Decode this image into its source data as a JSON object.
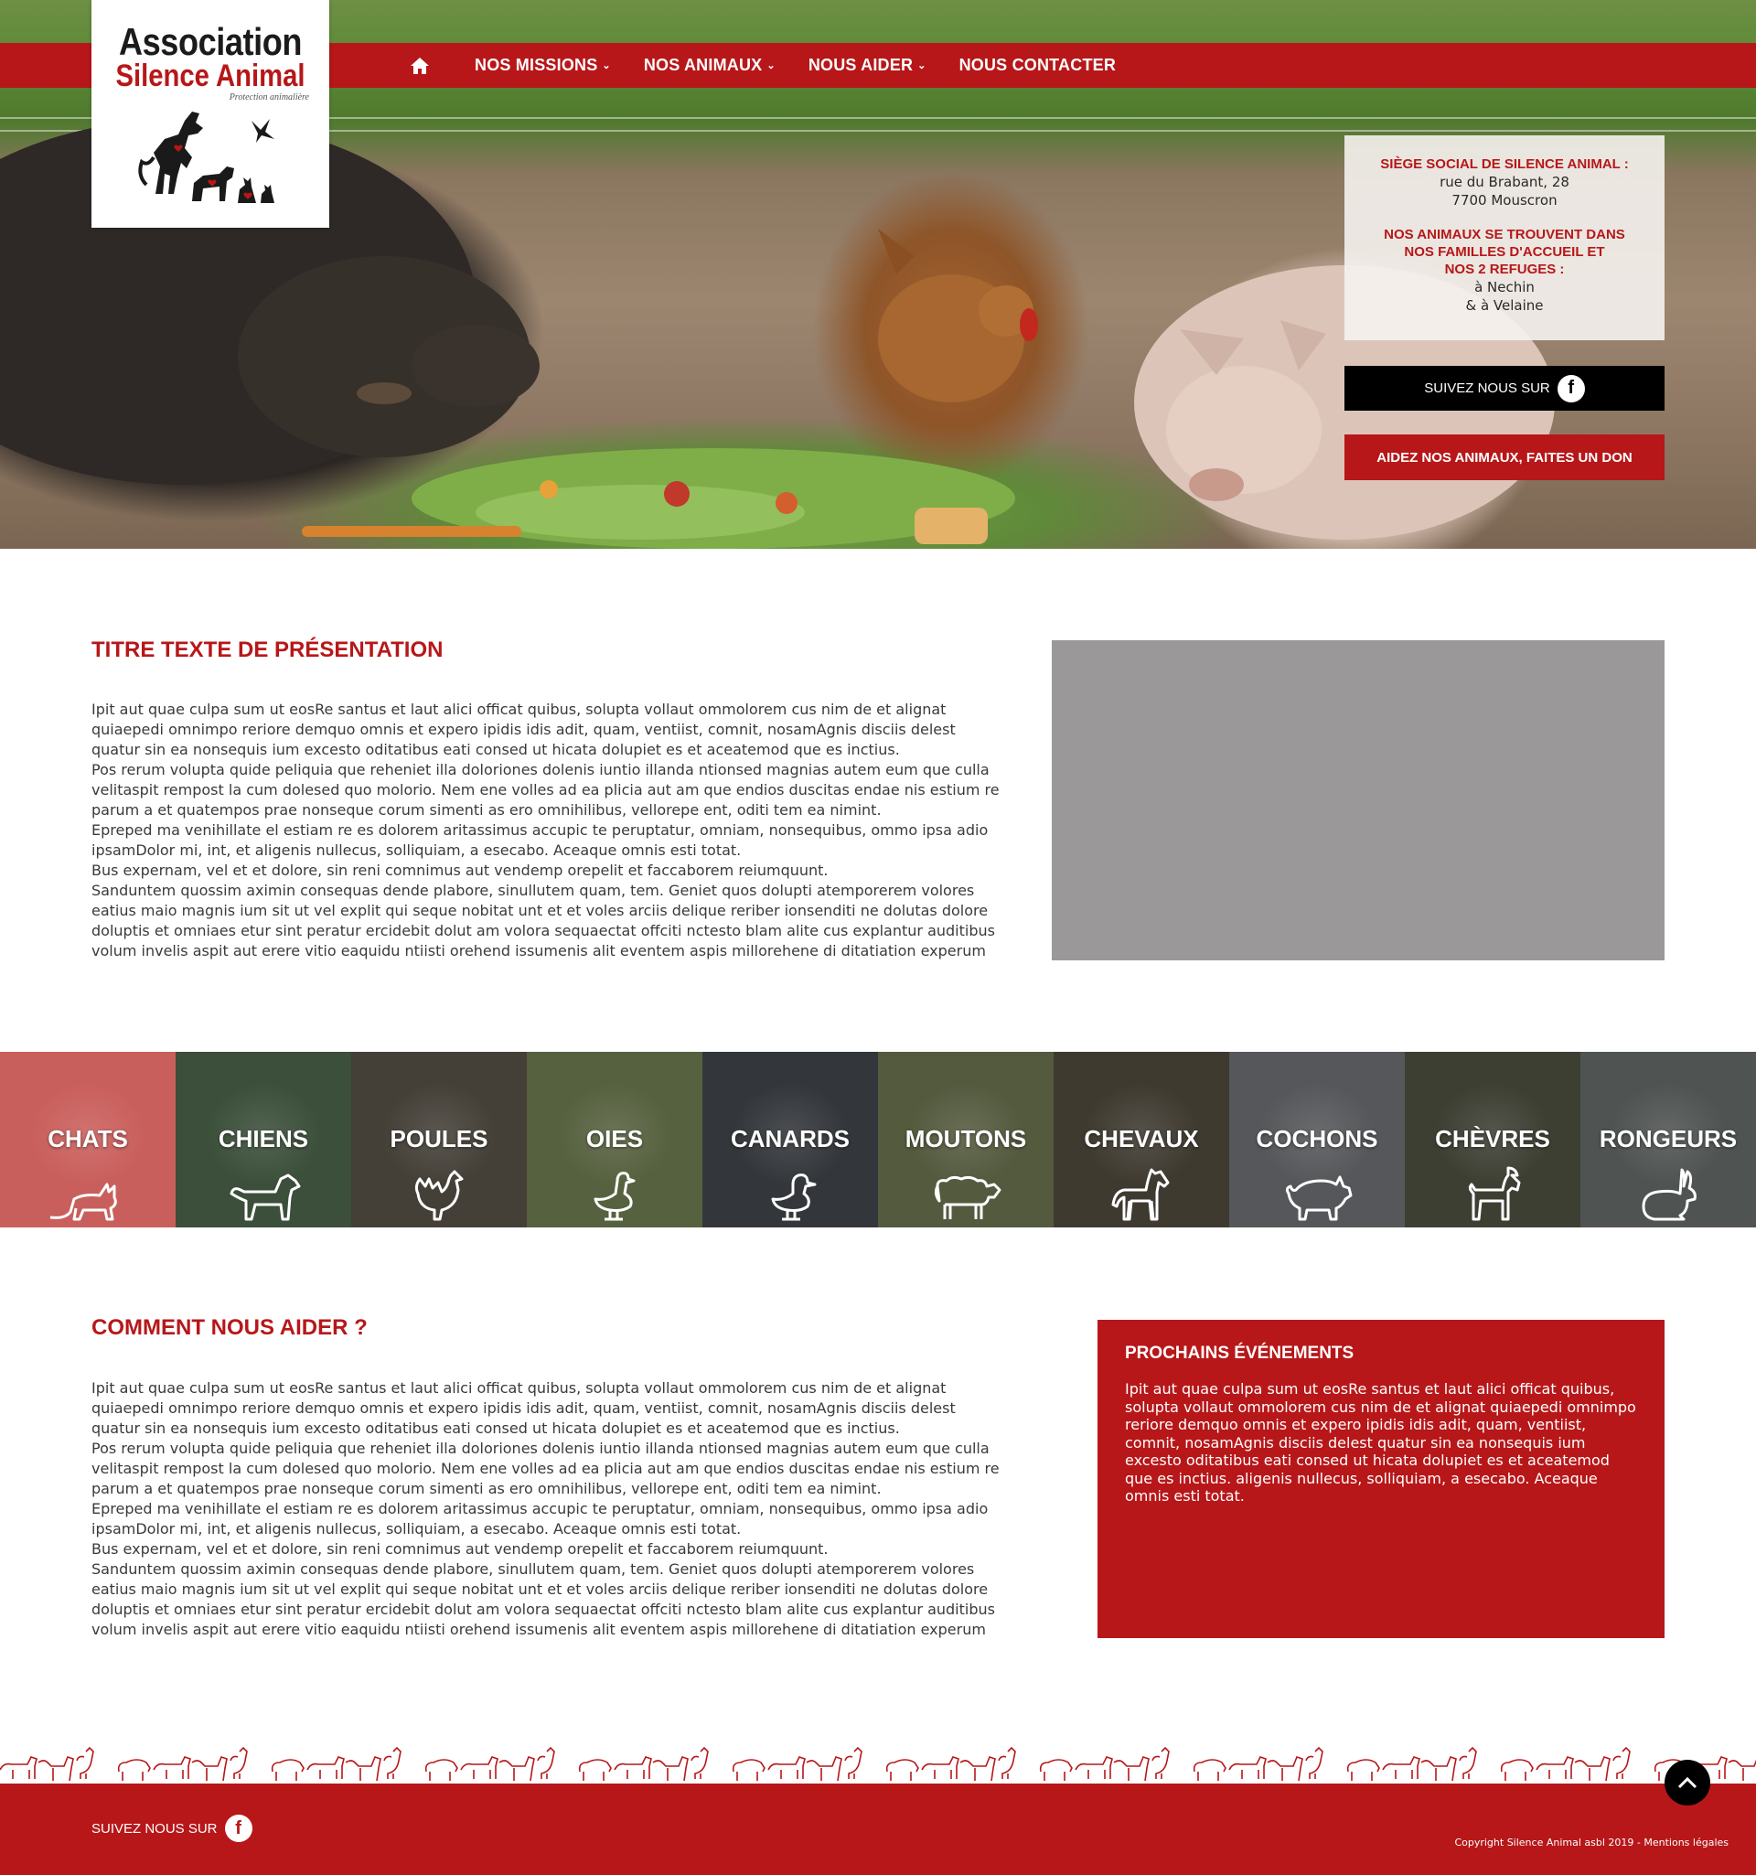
{
  "logo": {
    "line1": "Association",
    "line2": "Silence Animal",
    "tagline": "Protection animalière"
  },
  "nav": {
    "home_icon": "home-icon",
    "items": [
      {
        "label": "NOS MISSIONS",
        "has_dropdown": true
      },
      {
        "label": "NOS ANIMAUX",
        "has_dropdown": true
      },
      {
        "label": "NOUS AIDER",
        "has_dropdown": true
      },
      {
        "label": "NOUS CONTACTER",
        "has_dropdown": false
      }
    ]
  },
  "info": {
    "hq_title": "SIÈGE SOCIAL DE SILENCE ANIMAL :",
    "hq_address_1": "rue du Brabant, 28",
    "hq_address_2": "7700 Mouscron",
    "refuges_title_1": "NOS ANIMAUX SE TROUVENT DANS",
    "refuges_title_2": "NOS FAMILLES D'ACCUEIL ET",
    "refuges_title_3": "NOS 2 REFUGES :",
    "refuge_1": "à Nechin",
    "refuge_2": "& à Velaine"
  },
  "cta": {
    "follow_label": "SUIVEZ NOUS SUR",
    "facebook_icon": "facebook-icon",
    "donate_label": "AIDEZ NOS ANIMAUX, FAITES UN DON"
  },
  "presentation": {
    "title": "TITRE TEXTE DE PRÉSENTATION",
    "paragraphs": [
      "Ipit aut quae culpa sum ut eosRe santus et laut alici officat quibus, solupta vollaut ommolorem cus nim de et alignat quiaepedi omnimpo reriore demquo omnis et expero ipidis idis adit, quam, ventiist, comnit, nosamAgnis disciis delest quatur sin ea nonsequis ium excesto oditatibus eati consed ut hicata dolupiet es et aceatemod que es inctius.",
      "Pos rerum volupta quide peliquia que reheniet illa doloriones dolenis iuntio illanda ntionsed magnias autem eum que culla velitaspit rempost la cum dolesed quo molorio. Nem ene volles ad ea plicia aut am que endios duscitas endae nis estium re parum a et quatempos prae nonseque corum simenti as ero omnihilibus, vellorepe ent, oditi tem ea nimint.",
      "Epreped ma venihillate el estiam re es dolorem aritassimus accupic te peruptatur, omniam, nonsequibus, ommo ipsa adio ipsamDolor mi, int, et aligenis nullecus, solliquiam, a esecabo. Aceaque omnis esti totat.",
      "Bus expernam, vel et et dolore, sin reni comnimus aut vendemp orepelit et faccaborem reiumquunt.",
      "Sanduntem quossim aximin consequas dende plabore, sinullutem quam, tem. Geniet quos dolupti atemporerem volores eatius maio magnis ium sit ut vel explit qui seque nobitat unt et et voles arciis delique reriber ionsenditi ne dolutas dolore doluptis et omniaes etur sint peratur ercidebit dolut am volora sequaectat offciti nctesto blam alite cus explantur auditibus volum invelis aspit aut erere vitio eaquidu ntiisti orehend issumenis alit eventem aspis millorehene di ditatiation experum"
    ]
  },
  "animals": [
    {
      "name": "CHATS",
      "icon": "cat-icon",
      "color": "#c95f5c"
    },
    {
      "name": "CHIENS",
      "icon": "dog-icon",
      "color": "#3b4f3a"
    },
    {
      "name": "POULES",
      "icon": "hen-icon",
      "color": "#444038"
    },
    {
      "name": "OIES",
      "icon": "goose-icon",
      "color": "#56613f"
    },
    {
      "name": "CANARDS",
      "icon": "duck-icon",
      "color": "#33363a"
    },
    {
      "name": "MOUTONS",
      "icon": "sheep-icon",
      "color": "#545a3e"
    },
    {
      "name": "CHEVAUX",
      "icon": "horse-icon",
      "color": "#3e3a30"
    },
    {
      "name": "COCHONS",
      "icon": "pig-icon",
      "color": "#56575a"
    },
    {
      "name": "CHÈVRES",
      "icon": "goat-icon",
      "color": "#3d3f33"
    },
    {
      "name": "RONGEURS",
      "icon": "rabbit-icon",
      "color": "#4f5352"
    }
  ],
  "help": {
    "title": "COMMENT NOUS AIDER ?",
    "paragraphs": [
      "Ipit aut quae culpa sum ut eosRe santus et laut alici officat quibus, solupta vollaut ommolorem cus nim de et alignat quiaepedi omnimpo reriore demquo omnis et expero ipidis idis adit, quam, ventiist, comnit, nosamAgnis disciis delest quatur sin ea nonsequis ium excesto oditatibus eati consed ut hicata dolupiet es et aceatemod que es inctius.",
      "Pos rerum volupta quide peliquia que reheniet illa doloriones dolenis iuntio illanda ntionsed magnias autem eum que culla velitaspit rempost la cum dolesed quo molorio. Nem ene volles ad ea plicia aut am que endios duscitas endae nis estium re parum a et quatempos prae nonseque corum simenti as ero omnihilibus, vellorepe ent, oditi tem ea nimint.",
      "Epreped ma venihillate el estiam re es dolorem aritassimus accupic te peruptatur, omniam, nonsequibus, ommo ipsa adio ipsamDolor mi, int, et aligenis nullecus, solliquiam, a esecabo. Aceaque omnis esti totat.",
      "Bus expernam, vel et et dolore, sin reni comnimus aut vendemp orepelit et faccaborem reiumquunt.",
      "Sanduntem quossim aximin consequas dende plabore, sinullutem quam, tem. Geniet quos dolupti atemporerem volores eatius maio magnis ium sit ut vel explit qui seque nobitat unt et et voles arciis delique reriber ionsenditi ne dolutas dolore doluptis et omniaes etur sint peratur ercidebit dolut am volora sequaectat offciti nctesto blam alite cus explantur auditibus volum invelis aspit aut erere vitio eaquidu ntiisti orehend issumenis alit eventem aspis millorehene di ditatiation experum"
    ]
  },
  "events": {
    "title": "PROCHAINS ÉVÉNEMENTS",
    "text": "Ipit aut quae culpa sum ut eosRe santus et laut alici officat quibus, solupta vollaut ommolorem cus nim de et alignat quiaepedi omnimpo reriore demquo omnis et expero ipidis idis adit, quam, ventiist, comnit, nosamAgnis disciis delest quatur sin ea nonsequis ium excesto oditatibus eati consed ut hicata dolupiet es et aceatemod que es inctius. aligenis nullecus, solliquiam, a esecabo. Aceaque omnis esti totat."
  },
  "footer": {
    "follow_label": "SUIVEZ NOUS SUR",
    "facebook_icon": "facebook-icon",
    "copyright": "Copyright Silence Animal asbl 2019 - Mentions légales",
    "back_to_top_icon": "chevron-up-icon"
  },
  "colors": {
    "brand_red": "#b71719",
    "black": "#000000",
    "media_placeholder": "#9a9898"
  }
}
